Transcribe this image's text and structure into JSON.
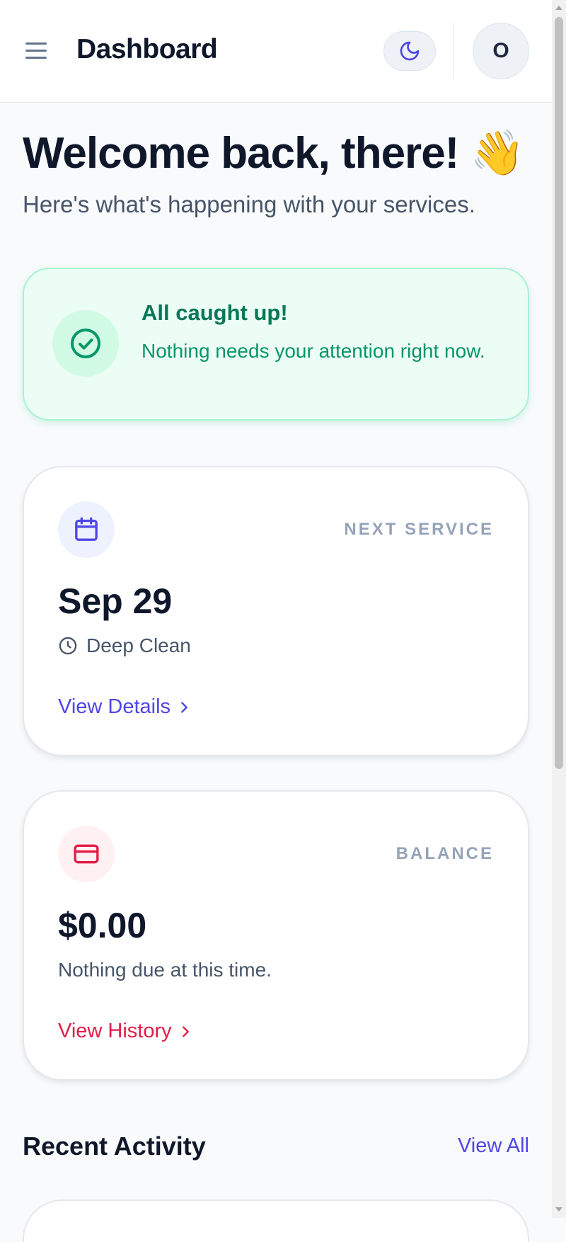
{
  "header": {
    "title": "Dashboard",
    "menu_icon": "hamburger-icon",
    "theme_icon": "moon-icon",
    "avatar_initial": "O"
  },
  "welcome": {
    "title": "Welcome back, there! 👋",
    "subtitle": "Here's what's happening with your services."
  },
  "status_card": {
    "icon": "check-circle-icon",
    "title": "All caught up!",
    "text": "Nothing needs your attention right now."
  },
  "next_service_card": {
    "icon": "calendar-icon",
    "label": "NEXT SERVICE",
    "value": "Sep 29",
    "service_icon": "clock-icon",
    "service": "Deep Clean",
    "link": "View Details",
    "link_icon": "chevron-right-icon"
  },
  "balance_card": {
    "icon": "credit-card-icon",
    "label": "BALANCE",
    "value": "$0.00",
    "note": "Nothing due at this time.",
    "link": "View History",
    "link_icon": "chevron-right-icon"
  },
  "recent_activity": {
    "title": "Recent Activity",
    "view_all": "View All"
  },
  "colors": {
    "accent": "#4f46e5",
    "success": "#059669",
    "danger": "#e11d48",
    "muted": "#94a3b8"
  }
}
